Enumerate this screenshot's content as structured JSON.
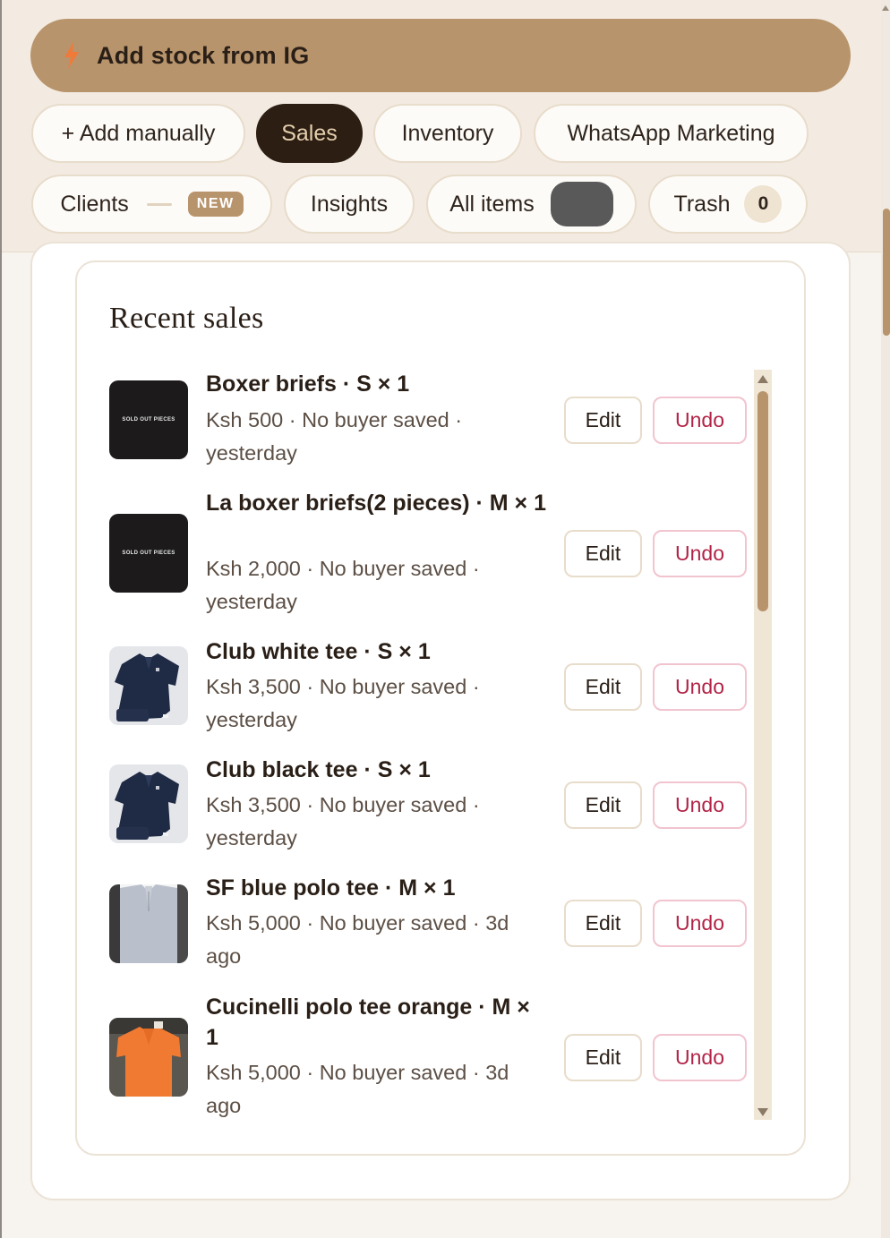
{
  "header": {
    "ig_button_label": "Add stock from IG",
    "tabs": [
      {
        "label": "+ Add manually"
      },
      {
        "label": "Sales"
      },
      {
        "label": "Inventory"
      },
      {
        "label": "WhatsApp Marketing"
      },
      {
        "label": "Clients",
        "badge": "NEW"
      },
      {
        "label": "Insights"
      },
      {
        "label": "All items"
      },
      {
        "label": "Trash",
        "count": "0"
      }
    ],
    "active_tab": "Sales"
  },
  "recent_sales": {
    "title": "Recent sales",
    "edit_label": "Edit",
    "undo_label": "Undo",
    "thumb_caption": "SOLD OUT PIECES",
    "items": [
      {
        "name": "Boxer briefs · S × 1",
        "meta": "Ksh 500 · No buyer saved · yesterday",
        "thumb": "sold-out-pieces"
      },
      {
        "name": "La boxer briefs(2 pieces) · M × 1",
        "meta": "Ksh 2,000 · No buyer saved · yesterday",
        "thumb": "sold-out-pieces"
      },
      {
        "name": "Club white tee · S × 1",
        "meta": "Ksh 3,500 · No buyer saved · yesterday",
        "thumb": "navy-polo"
      },
      {
        "name": "Club black tee · S × 1",
        "meta": "Ksh 3,500 · No buyer saved · yesterday",
        "thumb": "navy-polo"
      },
      {
        "name": "SF blue polo tee · M × 1",
        "meta": "Ksh 5,000 · No buyer saved · 3d ago",
        "thumb": "grey-polo"
      },
      {
        "name": "Cucinelli polo tee orange · M × 1",
        "meta": "Ksh 5,000 · No buyer saved · 3d ago",
        "thumb": "orange-polo"
      }
    ]
  },
  "colors": {
    "accent": "#b8946c",
    "active_tab_bg": "#2c1e12",
    "undo_text": "#b22447",
    "page_bg": "#f7f3ee"
  }
}
